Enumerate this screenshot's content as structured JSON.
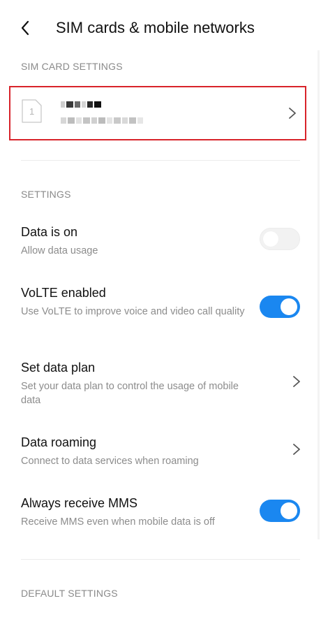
{
  "header": {
    "title": "SIM cards & mobile networks"
  },
  "sections": {
    "sim_card_settings": "SIM CARD SETTINGS",
    "settings": "SETTINGS",
    "default_settings": "DEFAULT SETTINGS"
  },
  "sim_card": {
    "slot_number": "1"
  },
  "settings": {
    "data": {
      "title": "Data is on",
      "subtitle": "Allow data usage",
      "enabled": false
    },
    "volte": {
      "title": "VoLTE enabled",
      "subtitle": "Use VoLTE to improve voice and video call quality",
      "enabled": true
    },
    "data_plan": {
      "title": "Set data plan",
      "subtitle": "Set your data plan to control the usage of mobile data"
    },
    "roaming": {
      "title": "Data roaming",
      "subtitle": "Connect to data services when roaming"
    },
    "mms": {
      "title": "Always receive MMS",
      "subtitle": "Receive MMS even when mobile data is off",
      "enabled": true
    }
  },
  "colors": {
    "accent": "#1a87f0",
    "highlight_border": "#d8232a"
  }
}
